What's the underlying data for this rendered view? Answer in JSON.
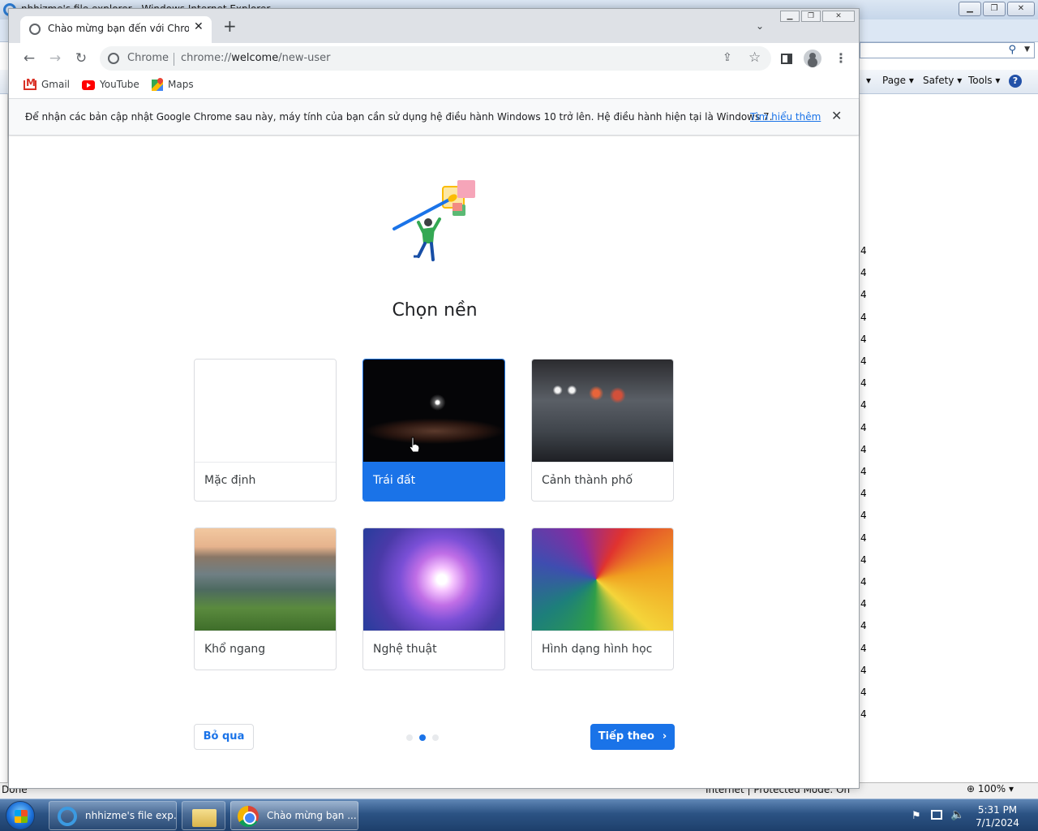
{
  "ie": {
    "window_title": "nhhizme's file explorer - Windows Internet Explorer",
    "commands": [
      "Page",
      "Safety",
      "Tools"
    ],
    "help_label": "?",
    "right_column_digit": "4",
    "status_done": "Done",
    "status_zone": "Internet | Protected Mode: On",
    "zoom": "100%"
  },
  "chrome": {
    "tab_title": "Chào mừng bạn đến với Chrome",
    "site_chip": "Chrome",
    "url_scheme": "chrome://",
    "url_host": "welcome",
    "url_path": "/new-user",
    "bookmarks": [
      {
        "label": "Gmail",
        "icon": "gmail-icon"
      },
      {
        "label": "YouTube",
        "icon": "youtube-icon"
      },
      {
        "label": "Maps",
        "icon": "maps-icon"
      }
    ],
    "infobar": {
      "message": "Để nhận các bản cập nhật Google Chrome sau này, máy tính của bạn cần sử dụng hệ điều hành Windows 10 trở lên. Hệ điều hành hiện tại là Windows 7.",
      "link": "Tìm hiểu thêm"
    }
  },
  "page": {
    "heading": "Chọn nền",
    "themes": [
      {
        "label": "Mặc định",
        "selected": false
      },
      {
        "label": "Trái đất",
        "selected": true
      },
      {
        "label": "Cảnh thành phố",
        "selected": false
      },
      {
        "label": "Khổ ngang",
        "selected": false
      },
      {
        "label": "Nghệ thuật",
        "selected": false
      },
      {
        "label": "Hình dạng hình học",
        "selected": false
      }
    ],
    "skip_label": "Bỏ qua",
    "next_label": "Tiếp theo",
    "step_dots": 3,
    "active_step": 2
  },
  "taskbar": {
    "items": [
      {
        "label": "nhhizme's file exp...",
        "icon": "internet-explorer-icon"
      },
      {
        "label": "",
        "icon": "folder-icon"
      },
      {
        "label": "Chào mừng bạn ...",
        "icon": "chrome-icon"
      }
    ],
    "time": "5:31 PM",
    "date": "7/1/2024"
  },
  "colors": {
    "accent": "#1a73e8",
    "taskbar": "#2c5384"
  }
}
